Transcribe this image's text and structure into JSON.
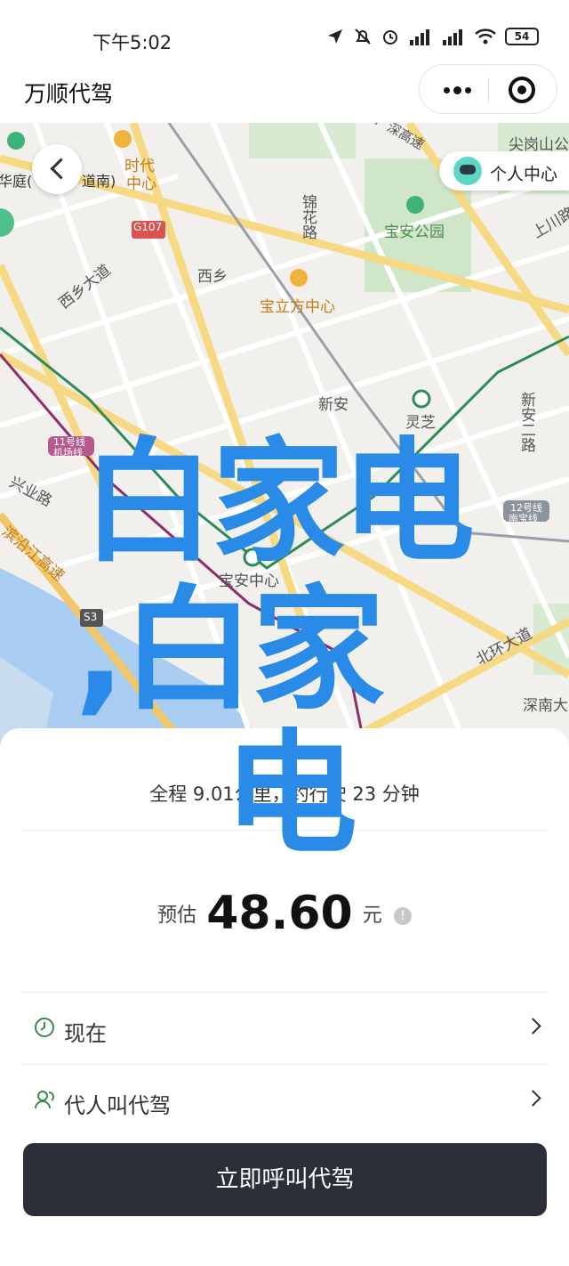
{
  "status_bar": {
    "time": "下午5:02",
    "battery": "54"
  },
  "header": {
    "title": "万顺代驾"
  },
  "map": {
    "back_partial_left": "华庭(",
    "back_partial_right": "道南)",
    "personal_center": "个人中心",
    "labels": {
      "shidai_1": "时代",
      "shidai_2": "中心",
      "g107": "G107",
      "xixiang_road": "西乡大道",
      "xixiang": "西乡",
      "jinhua": "锦花路",
      "baoan_park": "宝安公园",
      "baoli_center": "宝立方中心",
      "jiangang": "尖岗山公",
      "shangchuan": "上川路",
      "xinan": "新安",
      "lingzhi": "灵芝",
      "xinan_road": "新安二路",
      "xingye": "兴业路",
      "line11_1": "11号线",
      "line11_2": "机场线",
      "line12_1": "12号线",
      "line12_2": "南宝线",
      "coastal": "滨沿江高速",
      "baoan_center": "宝安中心",
      "s3": "S3",
      "beihuan": "北环大道",
      "shennan": "深南大",
      "guangshen": "广深高速"
    }
  },
  "overlay": {
    "line1": "白家电",
    "line2": ",白家",
    "line3": "电"
  },
  "trip": {
    "summary": "全程 9.01公里，约行驶 23 分钟",
    "price_prefix": "预估",
    "price_value": "48.60",
    "price_unit": "元",
    "info_glyph": "!"
  },
  "options": [
    {
      "label": "现在"
    },
    {
      "label": "代人叫代驾"
    }
  ],
  "cta": {
    "label": "立即呼叫代驾"
  }
}
